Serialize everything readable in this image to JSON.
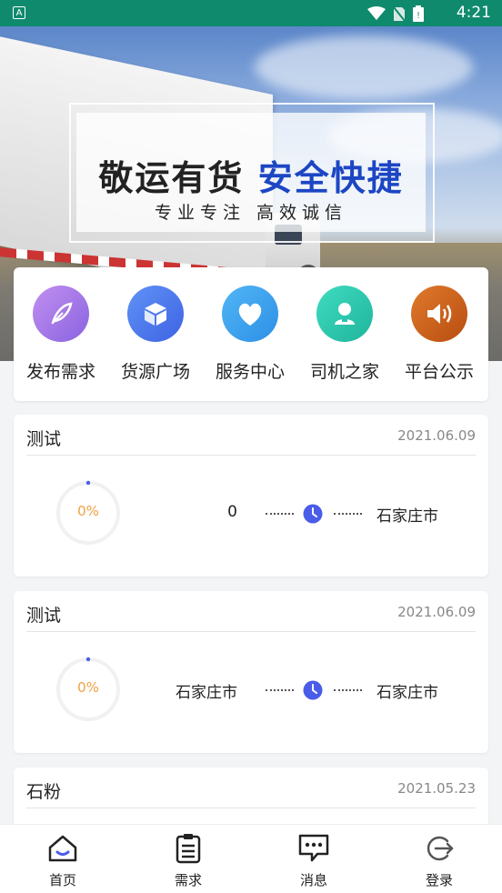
{
  "status_bar": {
    "time": "4:21",
    "app_icon_letter": "A"
  },
  "banner": {
    "slogan_part1": "敬运有货",
    "slogan_part2": "安全快捷",
    "sub_slogan": "专业专注 高效诚信"
  },
  "menu": {
    "items": [
      {
        "label": "发布需求",
        "icon": "feather-icon",
        "color": "#a07be8"
      },
      {
        "label": "货源广场",
        "icon": "box-icon",
        "color": "#4f7bf0"
      },
      {
        "label": "服务中心",
        "icon": "heart-icon",
        "color": "#3ba0ef"
      },
      {
        "label": "司机之家",
        "icon": "person-icon",
        "color": "#27c7ad"
      },
      {
        "label": "平台公示",
        "icon": "speaker-icon",
        "color": "#d9621e"
      }
    ]
  },
  "cards": [
    {
      "title": "测试",
      "date": "2021.06.09",
      "progress": "0%",
      "from": "0",
      "to": "石家庄市"
    },
    {
      "title": "测试",
      "date": "2021.06.09",
      "progress": "0%",
      "from": "石家庄市",
      "to": "石家庄市"
    },
    {
      "title": "石粉",
      "date": "2021.05.23"
    }
  ],
  "tabs": [
    {
      "label": "首页",
      "icon": "home-icon"
    },
    {
      "label": "需求",
      "icon": "clipboard-icon"
    },
    {
      "label": "消息",
      "icon": "message-icon"
    },
    {
      "label": "登录",
      "icon": "login-icon"
    }
  ],
  "colors": {
    "status_bar": "#108a6d",
    "accent_blue": "#1c46c4",
    "progress_text": "#f0a040",
    "clock": "#4a5de8"
  }
}
